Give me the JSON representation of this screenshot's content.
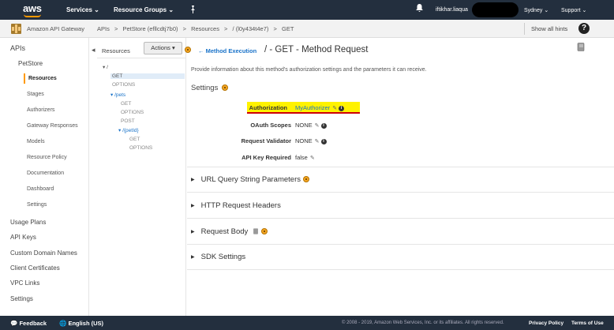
{
  "topbar": {
    "logo": "aws",
    "services": "Services",
    "resource_groups": "Resource Groups",
    "user": "iftikhar.liaqua",
    "region": "Sydney",
    "support": "Support",
    "chevron": "⌄",
    "pin_icon": "pin-icon",
    "bell_icon": "bell-icon"
  },
  "breadcrumb": {
    "items": [
      "Amazon API Gateway",
      "APIs",
      ">",
      "PetStore (efllcdtj7b0)",
      ">",
      "Resources",
      ">",
      "/ (l0y434t4e7)",
      ">",
      "GET"
    ],
    "show_hints": "Show all hints",
    "help": "?"
  },
  "sidebar": {
    "apis": "APIs",
    "petstore": "PetStore",
    "items": [
      "Resources",
      "Stages",
      "Authorizers",
      "Gateway Responses",
      "Models",
      "Resource Policy",
      "Documentation",
      "Dashboard",
      "Settings"
    ],
    "bottom": [
      "Usage Plans",
      "API Keys",
      "Custom Domain Names",
      "Client Certificates",
      "VPC Links",
      "Settings"
    ]
  },
  "tree": {
    "collapse": "◂",
    "header": "Resources",
    "actions": "Actions ▾",
    "nodes": {
      "root": "/",
      "get": "GET",
      "options": "OPTIONS",
      "pets": "/pets",
      "pets_get": "GET",
      "pets_options": "OPTIONS",
      "pets_post": "POST",
      "petid": "/{petId}",
      "petid_get": "GET",
      "petid_options": "OPTIONS"
    }
  },
  "main": {
    "back": "← Method Execution",
    "title": "/ - GET - Method Request",
    "description": "Provide information about this method's authorization settings and the parameters it can receive.",
    "settings_heading": "Settings",
    "fields": {
      "authorization_label": "Authorization",
      "authorization_value": "MyAuthorizer",
      "oauth_label": "OAuth Scopes",
      "oauth_value": "NONE",
      "validator_label": "Request Validator",
      "validator_value": "NONE",
      "apikey_label": "API Key Required",
      "apikey_value": "false"
    },
    "sections": [
      "URL Query String Parameters",
      "HTTP Request Headers",
      "Request Body",
      "SDK Settings"
    ]
  },
  "footer": {
    "feedback": "Feedback",
    "language": "English (US)",
    "copyright": "© 2008 - 2019, Amazon Web Services, Inc. or its affiliates. All rights reserved.",
    "privacy": "Privacy Policy",
    "terms": "Terms of Use"
  },
  "colors": {
    "nav": "#232f3e",
    "accent": "#ff9900",
    "link": "#1a73c9",
    "highlight": "#fff200"
  }
}
